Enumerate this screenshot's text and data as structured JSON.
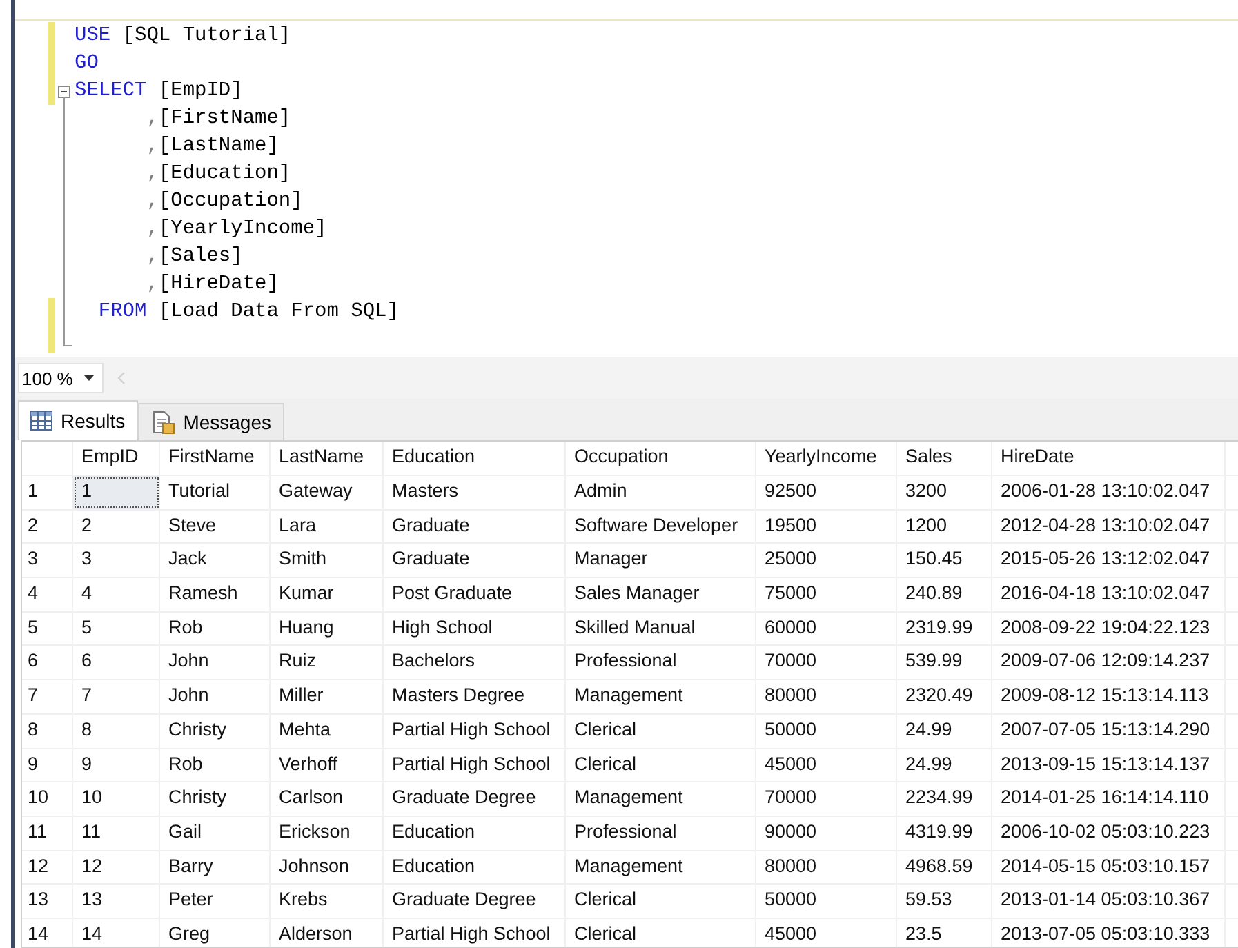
{
  "editor": {
    "lines": [
      {
        "modified": true,
        "kind": "plain",
        "segments": [
          {
            "kind": "keyword",
            "text": "USE"
          },
          {
            "kind": "plain",
            "text": " [SQL Tutorial]"
          }
        ]
      },
      {
        "modified": true,
        "kind": "plain",
        "segments": [
          {
            "kind": "keyword",
            "text": "GO"
          }
        ]
      },
      {
        "modified": true,
        "kind": "fold_start",
        "segments": [
          {
            "kind": "keyword",
            "text": "SELECT"
          },
          {
            "kind": "plain",
            "text": " [EmpID]"
          }
        ]
      },
      {
        "modified": false,
        "kind": "fold_inner",
        "segments": [
          {
            "kind": "punct",
            "text": "      ,"
          },
          {
            "kind": "plain",
            "text": "[FirstName]"
          }
        ]
      },
      {
        "modified": false,
        "kind": "fold_inner",
        "segments": [
          {
            "kind": "punct",
            "text": "      ,"
          },
          {
            "kind": "plain",
            "text": "[LastName]"
          }
        ]
      },
      {
        "modified": false,
        "kind": "fold_inner",
        "segments": [
          {
            "kind": "punct",
            "text": "      ,"
          },
          {
            "kind": "plain",
            "text": "[Education]"
          }
        ]
      },
      {
        "modified": false,
        "kind": "fold_inner",
        "segments": [
          {
            "kind": "punct",
            "text": "      ,"
          },
          {
            "kind": "plain",
            "text": "[Occupation]"
          }
        ]
      },
      {
        "modified": false,
        "kind": "fold_inner",
        "segments": [
          {
            "kind": "punct",
            "text": "      ,"
          },
          {
            "kind": "plain",
            "text": "[YearlyIncome]"
          }
        ]
      },
      {
        "modified": false,
        "kind": "fold_inner",
        "segments": [
          {
            "kind": "punct",
            "text": "      ,"
          },
          {
            "kind": "plain",
            "text": "[Sales]"
          }
        ]
      },
      {
        "modified": false,
        "kind": "fold_inner",
        "segments": [
          {
            "kind": "punct",
            "text": "      ,"
          },
          {
            "kind": "plain",
            "text": "[HireDate]"
          }
        ]
      },
      {
        "modified": true,
        "kind": "fold_inner",
        "segments": [
          {
            "kind": "keyword",
            "text": "  FROM"
          },
          {
            "kind": "plain",
            "text": " [Load Data From SQL]"
          }
        ]
      },
      {
        "modified": true,
        "kind": "fold_end"
      }
    ]
  },
  "zoom": {
    "value": "100 %"
  },
  "tabs": [
    {
      "label": "Results",
      "selected": true,
      "kind": "grid"
    },
    {
      "label": "Messages",
      "selected": false,
      "kind": "messages"
    }
  ],
  "table": {
    "columns": [
      "EmpID",
      "FirstName",
      "LastName",
      "Education",
      "Occupation",
      "YearlyIncome",
      "Sales",
      "HireDate"
    ],
    "rows": [
      {
        "number": "1",
        "focused": true,
        "cells": [
          "1",
          "Tutorial",
          "Gateway",
          "Masters",
          "Admin",
          "92500",
          "3200",
          "2006-01-28 13:10:02.047"
        ]
      },
      {
        "number": "2",
        "focused": false,
        "cells": [
          "2",
          "Steve",
          "Lara",
          "Graduate",
          "Software Developer",
          "19500",
          "1200",
          "2012-04-28 13:10:02.047"
        ]
      },
      {
        "number": "3",
        "focused": false,
        "cells": [
          "3",
          "Jack",
          "Smith",
          "Graduate",
          "Manager",
          "25000",
          "150.45",
          "2015-05-26 13:12:02.047"
        ]
      },
      {
        "number": "4",
        "focused": false,
        "cells": [
          "4",
          "Ramesh",
          "Kumar",
          "Post Graduate",
          "Sales Manager",
          "75000",
          "240.89",
          "2016-04-18 13:10:02.047"
        ]
      },
      {
        "number": "5",
        "focused": false,
        "cells": [
          "5",
          "Rob",
          "Huang",
          "High School",
          "Skilled Manual",
          "60000",
          "2319.99",
          "2008-09-22 19:04:22.123"
        ]
      },
      {
        "number": "6",
        "focused": false,
        "cells": [
          "6",
          "John",
          "Ruiz",
          "Bachelors",
          "Professional",
          "70000",
          "539.99",
          "2009-07-06 12:09:14.237"
        ]
      },
      {
        "number": "7",
        "focused": false,
        "cells": [
          "7",
          "John",
          "Miller",
          "Masters Degree",
          "Management",
          "80000",
          "2320.49",
          "2009-08-12 15:13:14.113"
        ]
      },
      {
        "number": "8",
        "focused": false,
        "cells": [
          "8",
          "Christy",
          "Mehta",
          "Partial High School",
          "Clerical",
          "50000",
          "24.99",
          "2007-07-05 15:13:14.290"
        ]
      },
      {
        "number": "9",
        "focused": false,
        "cells": [
          "9",
          "Rob",
          "Verhoff",
          "Partial High School",
          "Clerical",
          "45000",
          "24.99",
          "2013-09-15 15:13:14.137"
        ]
      },
      {
        "number": "10",
        "focused": false,
        "cells": [
          "10",
          "Christy",
          "Carlson",
          "Graduate Degree",
          "Management",
          "70000",
          "2234.99",
          "2014-01-25 16:14:14.110"
        ]
      },
      {
        "number": "11",
        "focused": false,
        "cells": [
          "11",
          "Gail",
          "Erickson",
          "Education",
          "Professional",
          "90000",
          "4319.99",
          "2006-10-02 05:03:10.223"
        ]
      },
      {
        "number": "12",
        "focused": false,
        "cells": [
          "12",
          "Barry",
          "Johnson",
          "Education",
          "Management",
          "80000",
          "4968.59",
          "2014-05-15 05:03:10.157"
        ]
      },
      {
        "number": "13",
        "focused": false,
        "cells": [
          "13",
          "Peter",
          "Krebs",
          "Graduate Degree",
          "Clerical",
          "50000",
          "59.53",
          "2013-01-14 05:03:10.367"
        ]
      },
      {
        "number": "14",
        "focused": false,
        "cells": [
          "14",
          "Greg",
          "Alderson",
          "Partial High School",
          "Clerical",
          "45000",
          "23.5",
          "2013-07-05 05:03:10.333"
        ]
      }
    ]
  }
}
